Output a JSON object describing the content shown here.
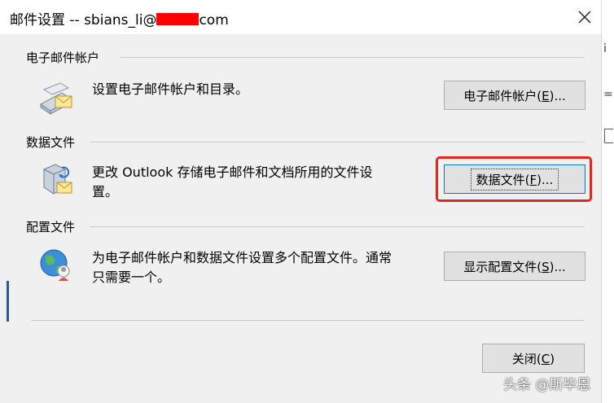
{
  "window": {
    "title_prefix": "邮件设置 --  sbians_li@",
    "title_suffix": "com"
  },
  "sections": {
    "email": {
      "header": "电子邮件帐户",
      "description": "设置电子邮件帐户和目录。",
      "button_label": "电子邮件帐户(",
      "button_key": "E",
      "button_tail": ")..."
    },
    "data": {
      "header": "数据文件",
      "description_line1": "更改 Outlook 存储电子邮件和文档所用的文件设",
      "description_line2": "置。",
      "button_label": "数据文件(",
      "button_key": "F",
      "button_tail": ")..."
    },
    "profile": {
      "header": "配置文件",
      "description_line1": "为电子邮件帐户和数据文件设置多个配置文件。通常",
      "description_line2": "只需要一个。",
      "button_label": "显示配置文件(",
      "button_key": "S",
      "button_tail": ")..."
    }
  },
  "footer": {
    "close_label": "关闭(",
    "close_key": "C",
    "close_tail": ")"
  },
  "watermark": "头条 @斯毕恩",
  "icons": {
    "email": "email-account-icon",
    "data": "data-file-icon",
    "profile": "profile-globe-icon",
    "close": "close-icon"
  },
  "colors": {
    "highlight": "#e4261c",
    "redaction": "#ff0000",
    "focus_border": "#0078d7"
  }
}
